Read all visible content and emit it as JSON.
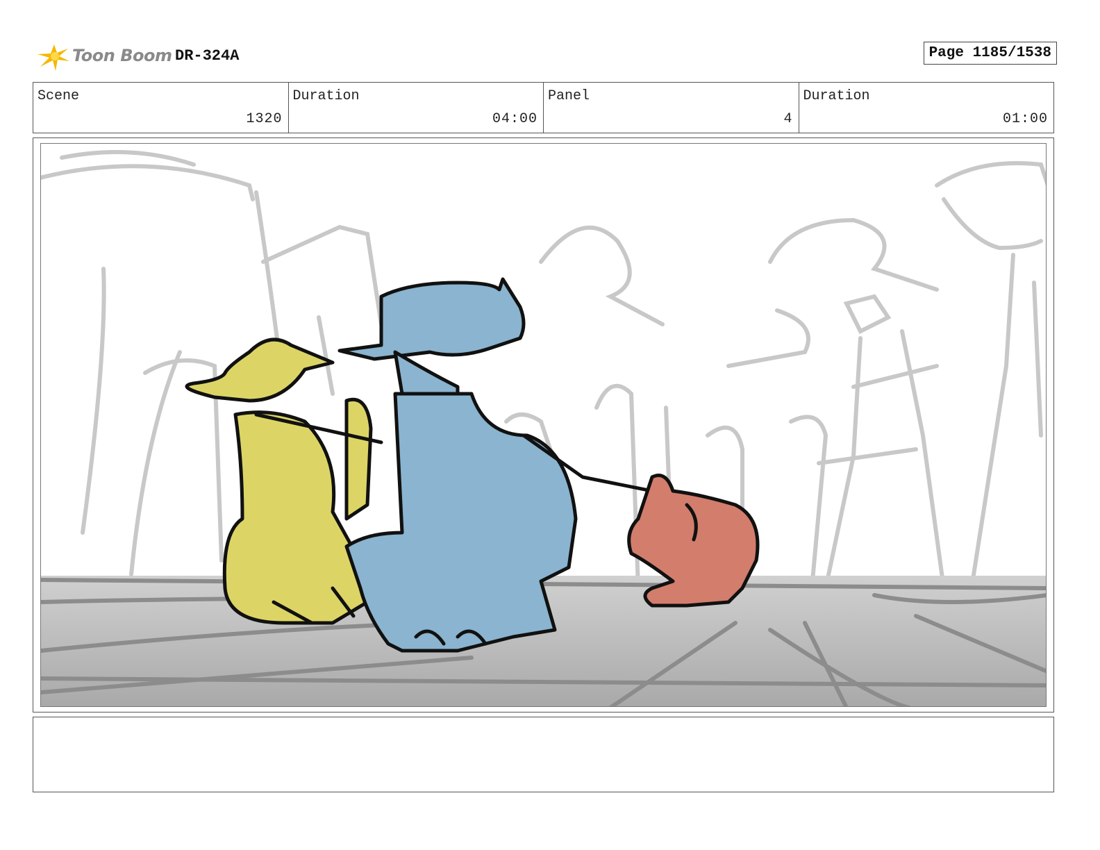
{
  "header": {
    "logo_text": "Toon Boom",
    "doc_id": "DR-324A",
    "page": "Page 1185/1538"
  },
  "info": {
    "scene_label": "Scene",
    "scene_value": "1320",
    "scene_duration_label": "Duration",
    "scene_duration_value": "04:00",
    "panel_label": "Panel",
    "panel_value": "4",
    "panel_duration_label": "Duration",
    "panel_duration_value": "01:00"
  },
  "panel_image": {
    "icon": "storyboard-sketch-image",
    "colors": {
      "left_character": "#dcd566",
      "center_character": "#8ab4cf",
      "right_creature": "#d37d6c",
      "ground": "#bdbdbd",
      "background_lines": "#c8c8c8",
      "ink": "#111111"
    }
  },
  "notes": {
    "text": ""
  }
}
